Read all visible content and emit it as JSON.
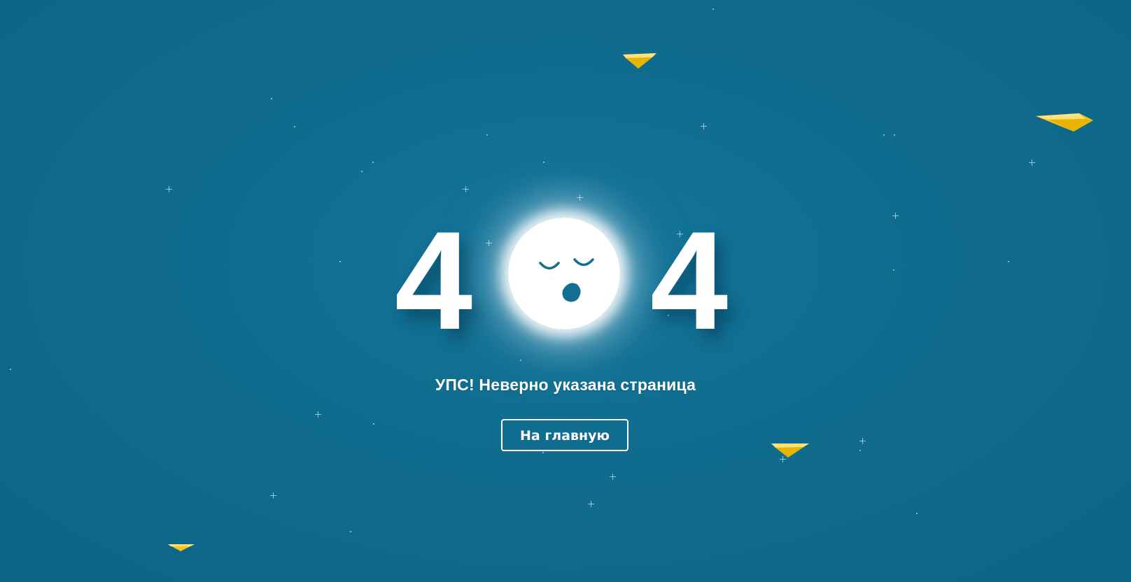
{
  "page": {
    "background_color": "#106c8e",
    "accent_plane_color": "#f5c518"
  },
  "error": {
    "code_left_digit": "4",
    "code_right_digit": "4",
    "moon_icon": "sleeping-moon-face",
    "message": "УПС! Неверно указана страница"
  },
  "actions": {
    "home_button_label": "На главную"
  }
}
